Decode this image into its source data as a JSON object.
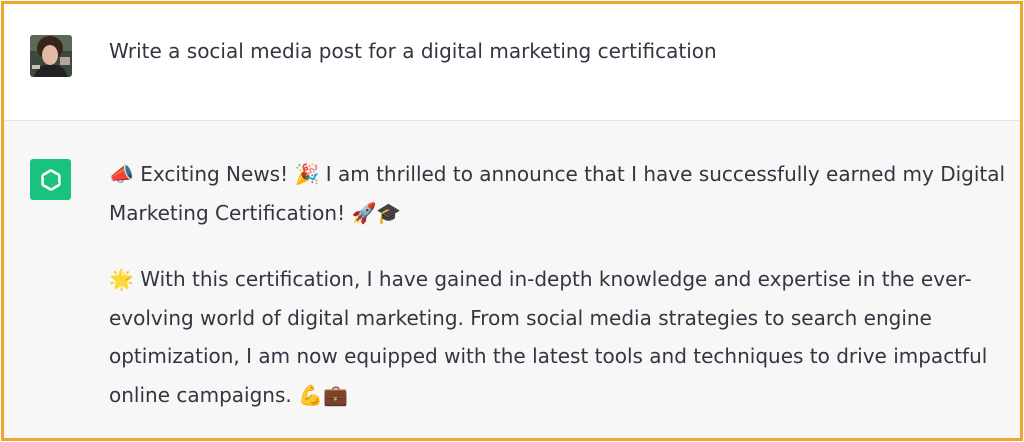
{
  "user_message": {
    "text": "Write a social media post for a digital marketing certification"
  },
  "assistant_message": {
    "paragraphs": [
      {
        "lines": [
          "📣 Exciting News! 🎉 I am thrilled to announce that I have successfully earned my Digital",
          "Marketing Certification! 🚀🎓"
        ]
      },
      {
        "lines": [
          "🌟 With this certification, I have gained in-depth knowledge and expertise in the ever-",
          "evolving world of digital marketing. From social media strategies to search engine",
          "optimization, I am now equipped with the latest tools and techniques to drive impactful",
          "online campaigns. 💪💼"
        ]
      }
    ]
  },
  "icons": {
    "user_avatar": "user-photo-avatar",
    "assistant_avatar": "chatgpt-logo-icon"
  },
  "colors": {
    "frame_border": "#f1a52f",
    "assistant_background": "#f7f7f8",
    "text": "#343541",
    "logo_background": "#19c37d"
  }
}
